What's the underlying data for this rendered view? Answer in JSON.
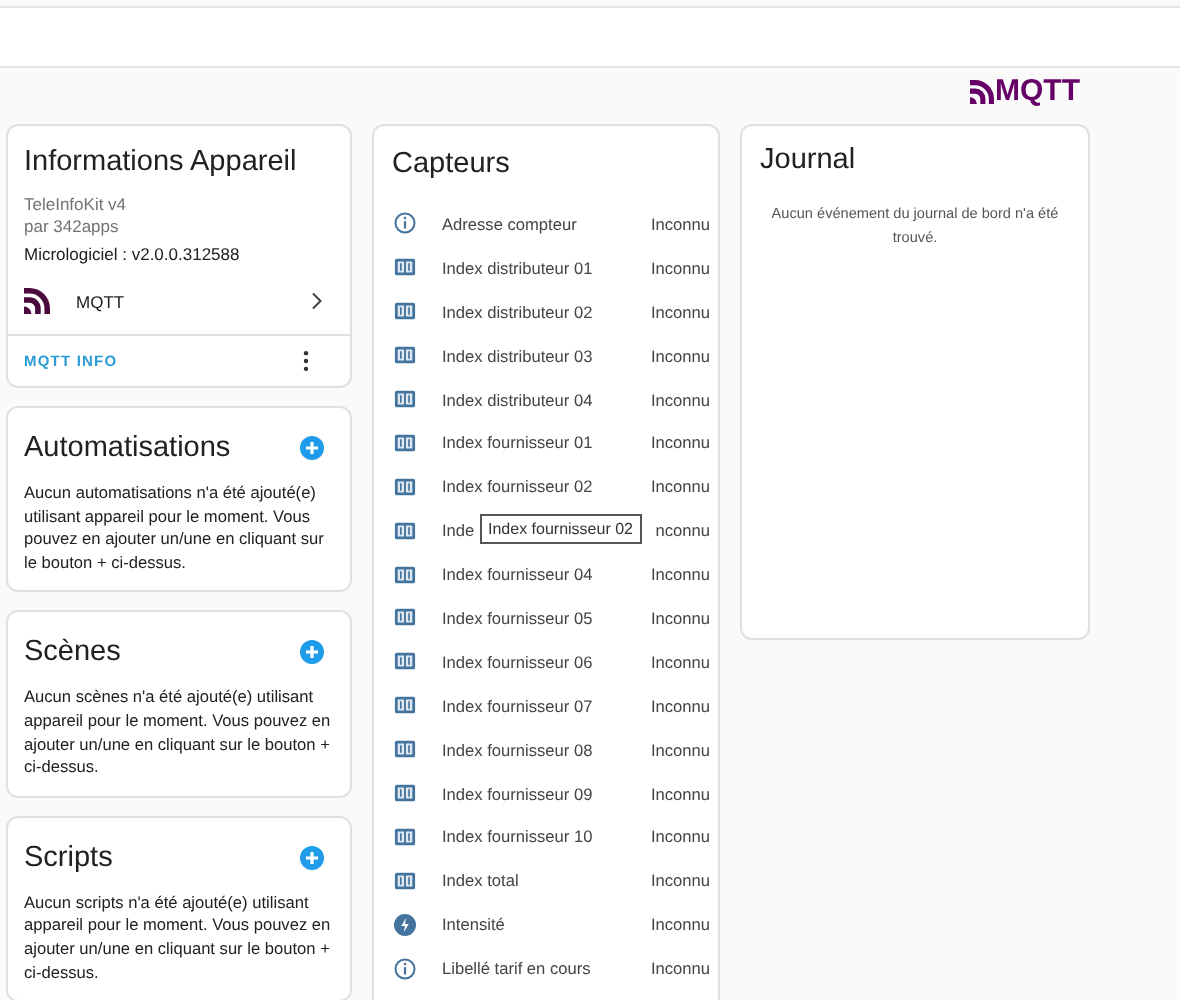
{
  "header": {
    "logo_text": "MQTT"
  },
  "device_info": {
    "title": "Informations Appareil",
    "model": "TeleInfoKit v4",
    "manufacturer": "par 342apps",
    "firmware": "Micrologiciel : v2.0.0.312588",
    "integration": {
      "name": "MQTT"
    },
    "action_link": "MQTT INFO"
  },
  "sections": [
    {
      "title": "Automatisations",
      "message": "Aucun automatisations n'a été ajouté(e) utilisant appareil pour le moment. Vous pouvez en ajouter un/une en cliquant sur le bouton + ci-dessus."
    },
    {
      "title": "Scènes",
      "message": "Aucun scènes n'a été ajouté(e) utilisant appareil pour le moment. Vous pouvez en ajouter un/une en cliquant sur le bouton + ci-dessus."
    },
    {
      "title": "Scripts",
      "message": "Aucun scripts n'a été ajouté(e) utilisant appareil pour le moment. Vous pouvez en ajouter un/une en cliquant sur le bouton + ci-dessus."
    }
  ],
  "sensors": {
    "title": "Capteurs",
    "rows": [
      {
        "kind": "info",
        "name": "Adresse compteur",
        "value": "Inconnu"
      },
      {
        "kind": "counter",
        "name": "Index distributeur 01",
        "value": "Inconnu"
      },
      {
        "kind": "counter",
        "name": "Index distributeur 02",
        "value": "Inconnu"
      },
      {
        "kind": "counter",
        "name": "Index distributeur 03",
        "value": "Inconnu"
      },
      {
        "kind": "counter",
        "name": "Index distributeur 04",
        "value": "Inconnu"
      },
      {
        "kind": "counter",
        "name": "Index fournisseur 01",
        "value": "Inconnu"
      },
      {
        "kind": "counter",
        "name": "Index fournisseur 02",
        "value": "Inconnu"
      },
      {
        "kind": "counter",
        "name": "Inde",
        "value": "nconnu",
        "tooltip": "Index fournisseur 02"
      },
      {
        "kind": "counter",
        "name": "Index fournisseur 04",
        "value": "Inconnu"
      },
      {
        "kind": "counter",
        "name": "Index fournisseur 05",
        "value": "Inconnu"
      },
      {
        "kind": "counter",
        "name": "Index fournisseur 06",
        "value": "Inconnu"
      },
      {
        "kind": "counter",
        "name": "Index fournisseur 07",
        "value": "Inconnu"
      },
      {
        "kind": "counter",
        "name": "Index fournisseur 08",
        "value": "Inconnu"
      },
      {
        "kind": "counter",
        "name": "Index fournisseur 09",
        "value": "Inconnu"
      },
      {
        "kind": "counter",
        "name": "Index fournisseur 10",
        "value": "Inconnu"
      },
      {
        "kind": "counter",
        "name": "Index total",
        "value": "Inconnu"
      },
      {
        "kind": "bolt",
        "name": "Intensité",
        "value": "Inconnu"
      },
      {
        "kind": "info",
        "name": "Libellé tarif en cours",
        "value": "Inconnu"
      }
    ]
  },
  "journal": {
    "title": "Journal",
    "message": "Aucun événement du journal de bord n'a été trouvé."
  }
}
